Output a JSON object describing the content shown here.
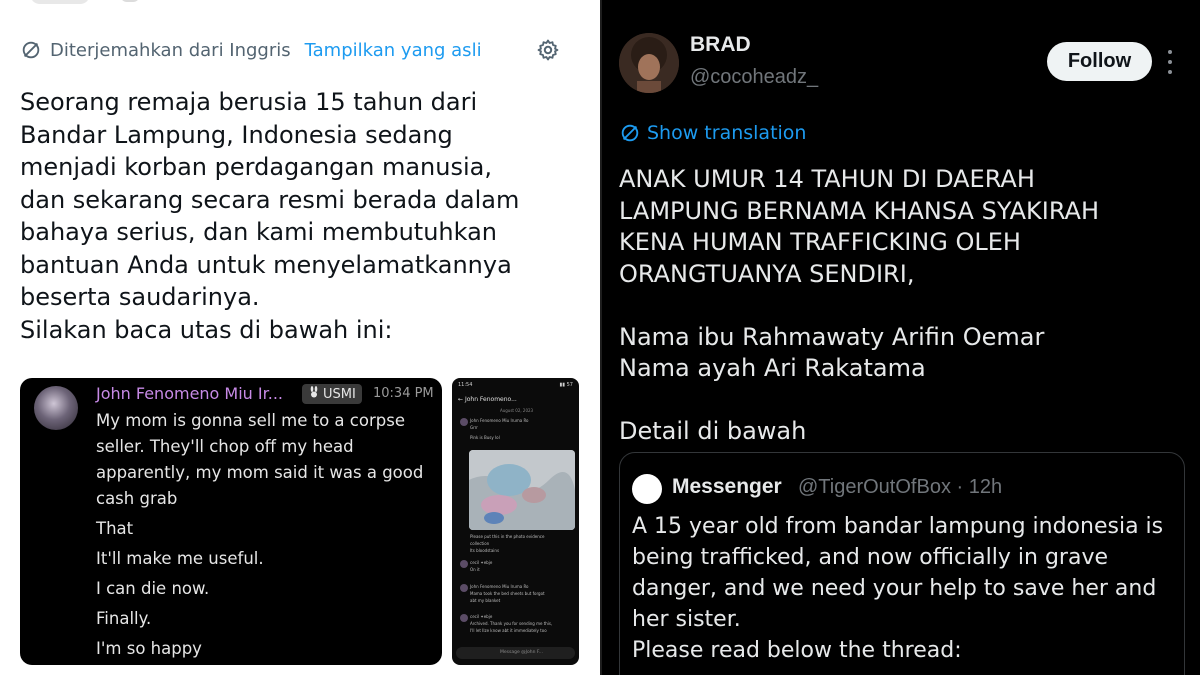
{
  "left": {
    "translation_notice": "Diterjemahkan dari Inggris",
    "show_original": "Tampilkan yang asli",
    "tweet_lines": [
      "Seorang remaja berusia 15 tahun dari",
      "Bandar Lampung, Indonesia sedang",
      "menjadi korban perdagangan manusia,",
      "dan sekarang secara resmi berada dalam",
      "bahaya serius, dan kami membutuhkan",
      "bantuan Anda untuk menyelamatkannya",
      "beserta saudarinya.",
      "Silakan baca utas di bawah ini:"
    ],
    "chat": {
      "name": "John Fenomeno Miu Ir...",
      "badge": "USMI",
      "time": "10:34 PM",
      "lines": [
        "My mom is gonna sell me to a corpse",
        "seller. They'll chop off my head",
        "apparently, my mom said it was a good",
        "cash grab",
        "That",
        "It'll make me useful.",
        "I can die now.",
        "Finally.",
        "I'm so happy"
      ]
    },
    "phone": {
      "status_time": "11:54",
      "status_right": "▮▮ 57",
      "header": "John Fenomeno...",
      "date": "August 02, 2023",
      "msg1_name": "John Fenomeno Miu Iruma Ro",
      "msg1_text": "Grrr",
      "msg1_sub": "Pink is Busy lol",
      "caption1": "Please put this in the photo evidence",
      "caption2": "collection",
      "caption3": "Its bloodstains",
      "msg2_name": "cecil ✦ebje",
      "msg2_text": "On it",
      "msg3_name": "John Fenomeno Miu Iruma Ro",
      "msg3_text": "Mama took the bed sheets but forgot",
      "msg3_text2": "abt my blanket",
      "msg4_name": "cecil ✦ebje",
      "msg4_text": "Archived. Thank you for sending me this,",
      "msg4_text2": "I'll let Ilze know abt it immediately too",
      "input_placeholder": "Message @John F..."
    }
  },
  "right": {
    "display_name": "BRAD",
    "handle": "@cocoheadz_",
    "follow_label": "Follow",
    "show_translation": "Show translation",
    "body_lines": [
      "ANAK UMUR 14 TAHUN DI DAERAH",
      "LAMPUNG BERNAMA KHANSA SYAKIRAH",
      "KENA HUMAN TRAFFICKING OLEH",
      "ORANGTUANYA SENDIRI,",
      "",
      "Nama ibu Rahmawaty Arifin Oemar",
      "Nama ayah Ari Rakatama",
      "",
      "Detail di bawah"
    ],
    "quote": {
      "name": "Messenger",
      "meta": "@TigerOutOfBox · 12h",
      "lines": [
        "A 15 year old from bandar lampung indonesia is",
        "being trafficked, and now officially in grave",
        "danger, and we need your help to save her and",
        "her sister.",
        "Please read below the thread:"
      ]
    }
  },
  "colors": {
    "link_blue": "#1d9bf0",
    "discord_pink": "#c78ae6",
    "dark_bg": "#000000",
    "light_bg": "#ffffff"
  },
  "icons": [
    "translate-icon",
    "gear-icon",
    "more-options-icon",
    "bunny-icon"
  ]
}
